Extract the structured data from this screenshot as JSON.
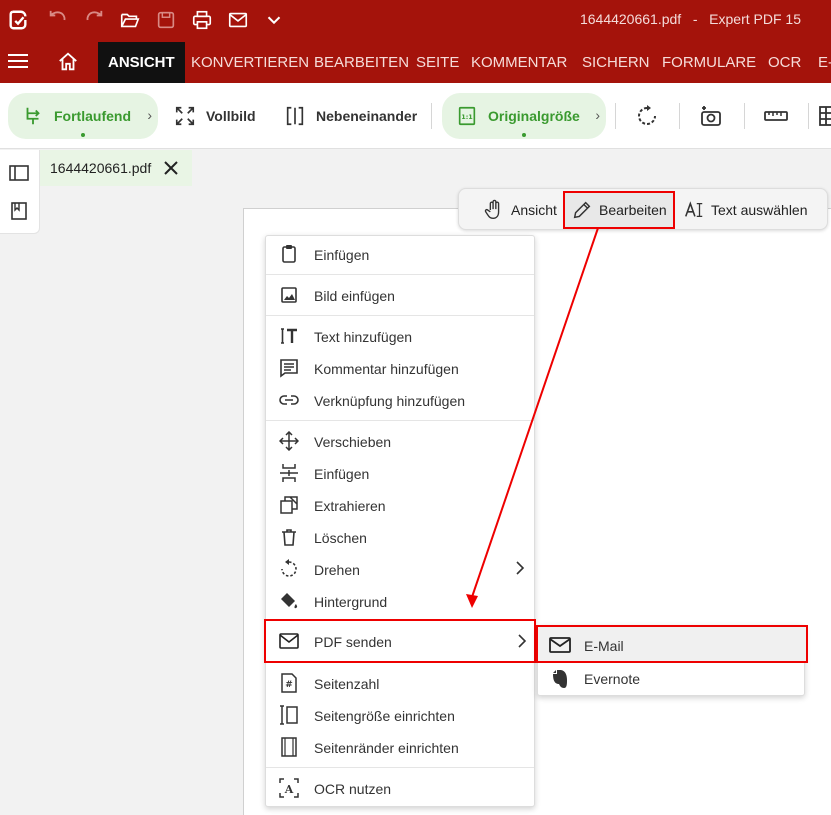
{
  "window": {
    "title": "1644420661.pdf   -   Expert PDF 15",
    "brand_color": "#a4130b"
  },
  "quick_access": {
    "icons": [
      "app-logo-icon",
      "undo-icon",
      "redo-icon",
      "open-folder-icon",
      "save-icon",
      "print-icon",
      "email-icon",
      "chevron-down-icon"
    ]
  },
  "menubar": {
    "tabs": [
      {
        "label": "ANSICHT",
        "active": true
      },
      {
        "label": "KONVERTIEREN",
        "active": false
      },
      {
        "label": "BEARBEITEN",
        "active": false
      },
      {
        "label": "SEITE",
        "active": false
      },
      {
        "label": "KOMMENTAR",
        "active": false
      },
      {
        "label": "SICHERN",
        "active": false
      },
      {
        "label": "FORMULARE",
        "active": false
      },
      {
        "label": "OCR",
        "active": false
      },
      {
        "label": "E-",
        "active": false
      }
    ]
  },
  "ribbon": {
    "continuous": "Fortlaufend",
    "fullscreen": "Vollbild",
    "side_by_side": "Nebeneinander",
    "original_size": "Originalgröße",
    "accent_color": "#3a9a2f"
  },
  "document": {
    "tab_label": "1644420661.pdf"
  },
  "modebar": {
    "view": "Ansicht",
    "edit": "Bearbeiten",
    "select_text": "Text auswählen"
  },
  "context_menu": {
    "items": [
      {
        "label": "Einfügen",
        "icon": "clipboard-icon"
      },
      {
        "label": "Bild einfügen",
        "icon": "image-icon"
      },
      {
        "label": "Text hinzufügen",
        "icon": "text-cursor-icon"
      },
      {
        "label": "Kommentar hinzufügen",
        "icon": "comment-icon"
      },
      {
        "label": "Verknüpfung hinzufügen",
        "icon": "link-icon"
      },
      {
        "label": "Verschieben",
        "icon": "move-icon"
      },
      {
        "label": "Einfügen",
        "icon": "insert-page-icon"
      },
      {
        "label": "Extrahieren",
        "icon": "extract-icon"
      },
      {
        "label": "Löschen",
        "icon": "trash-icon"
      },
      {
        "label": "Drehen",
        "icon": "rotate-icon"
      },
      {
        "label": "Hintergrund",
        "icon": "paint-bucket-icon"
      },
      {
        "label": "PDF senden",
        "icon": "email-icon"
      },
      {
        "label": "Seitenzahl",
        "icon": "page-number-icon"
      },
      {
        "label": "Seitengröße einrichten",
        "icon": "page-size-icon"
      },
      {
        "label": "Seitenränder einrichten",
        "icon": "page-margins-icon"
      },
      {
        "label": "OCR nutzen",
        "icon": "ocr-icon"
      }
    ]
  },
  "submenu": {
    "items": [
      {
        "label": "E-Mail",
        "icon": "email-icon"
      },
      {
        "label": "Evernote",
        "icon": "evernote-icon"
      }
    ]
  },
  "annotation_color": "#e00000"
}
